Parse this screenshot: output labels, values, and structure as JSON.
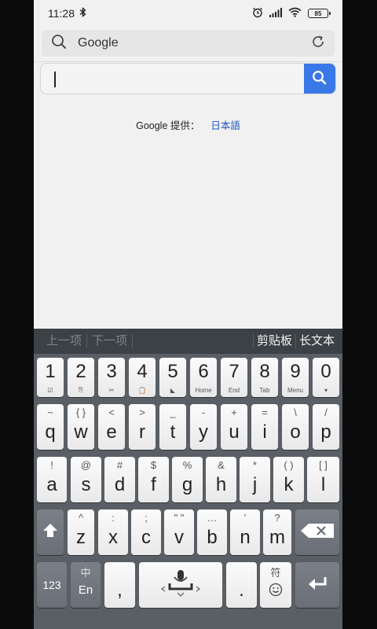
{
  "status": {
    "time": "11:28",
    "battery": "85"
  },
  "browser": {
    "url": "Google"
  },
  "page": {
    "provided_by": "Google 提供：",
    "language_link": "日本語"
  },
  "keyboard": {
    "toolbar": {
      "prev": "上一项",
      "next": "下一项",
      "clipboard": "剪贴板",
      "long_text": "长文本"
    },
    "number_row": [
      {
        "main": "1",
        "sub": "☑"
      },
      {
        "main": "2",
        "sub": "⎘"
      },
      {
        "main": "3",
        "sub": "✂"
      },
      {
        "main": "4",
        "sub": "📋"
      },
      {
        "main": "5",
        "sub": "◣"
      },
      {
        "main": "6",
        "sub": "Home"
      },
      {
        "main": "7",
        "sub": "End"
      },
      {
        "main": "8",
        "sub": "Tab"
      },
      {
        "main": "9",
        "sub": "Menu"
      },
      {
        "main": "0",
        "sub": "▾"
      }
    ],
    "row1": [
      {
        "main": "q",
        "top": "~"
      },
      {
        "main": "w",
        "top": "{ }"
      },
      {
        "main": "e",
        "top": "<"
      },
      {
        "main": "r",
        "top": ">"
      },
      {
        "main": "t",
        "top": "_"
      },
      {
        "main": "y",
        "top": "-"
      },
      {
        "main": "u",
        "top": "+"
      },
      {
        "main": "i",
        "top": "="
      },
      {
        "main": "o",
        "top": "\\"
      },
      {
        "main": "p",
        "top": "/"
      }
    ],
    "row2": [
      {
        "main": "a",
        "top": "!"
      },
      {
        "main": "s",
        "top": "@"
      },
      {
        "main": "d",
        "top": "#"
      },
      {
        "main": "f",
        "top": "$"
      },
      {
        "main": "g",
        "top": "%"
      },
      {
        "main": "h",
        "top": "&"
      },
      {
        "main": "j",
        "top": "*"
      },
      {
        "main": "k",
        "top": "( )"
      },
      {
        "main": "l",
        "top": "[ ]"
      }
    ],
    "row3": [
      {
        "main": "z",
        "top": "^"
      },
      {
        "main": "x",
        "top": ":"
      },
      {
        "main": "c",
        "top": ";"
      },
      {
        "main": "v",
        "top": "\" \""
      },
      {
        "main": "b",
        "top": "…"
      },
      {
        "main": "n",
        "top": "'"
      },
      {
        "main": "m",
        "top": "?"
      }
    ],
    "bottom": {
      "num_label": "123",
      "lang_top": "中",
      "lang_main": "En",
      "comma": ",",
      "period": ".",
      "symbol_top": "符"
    }
  }
}
